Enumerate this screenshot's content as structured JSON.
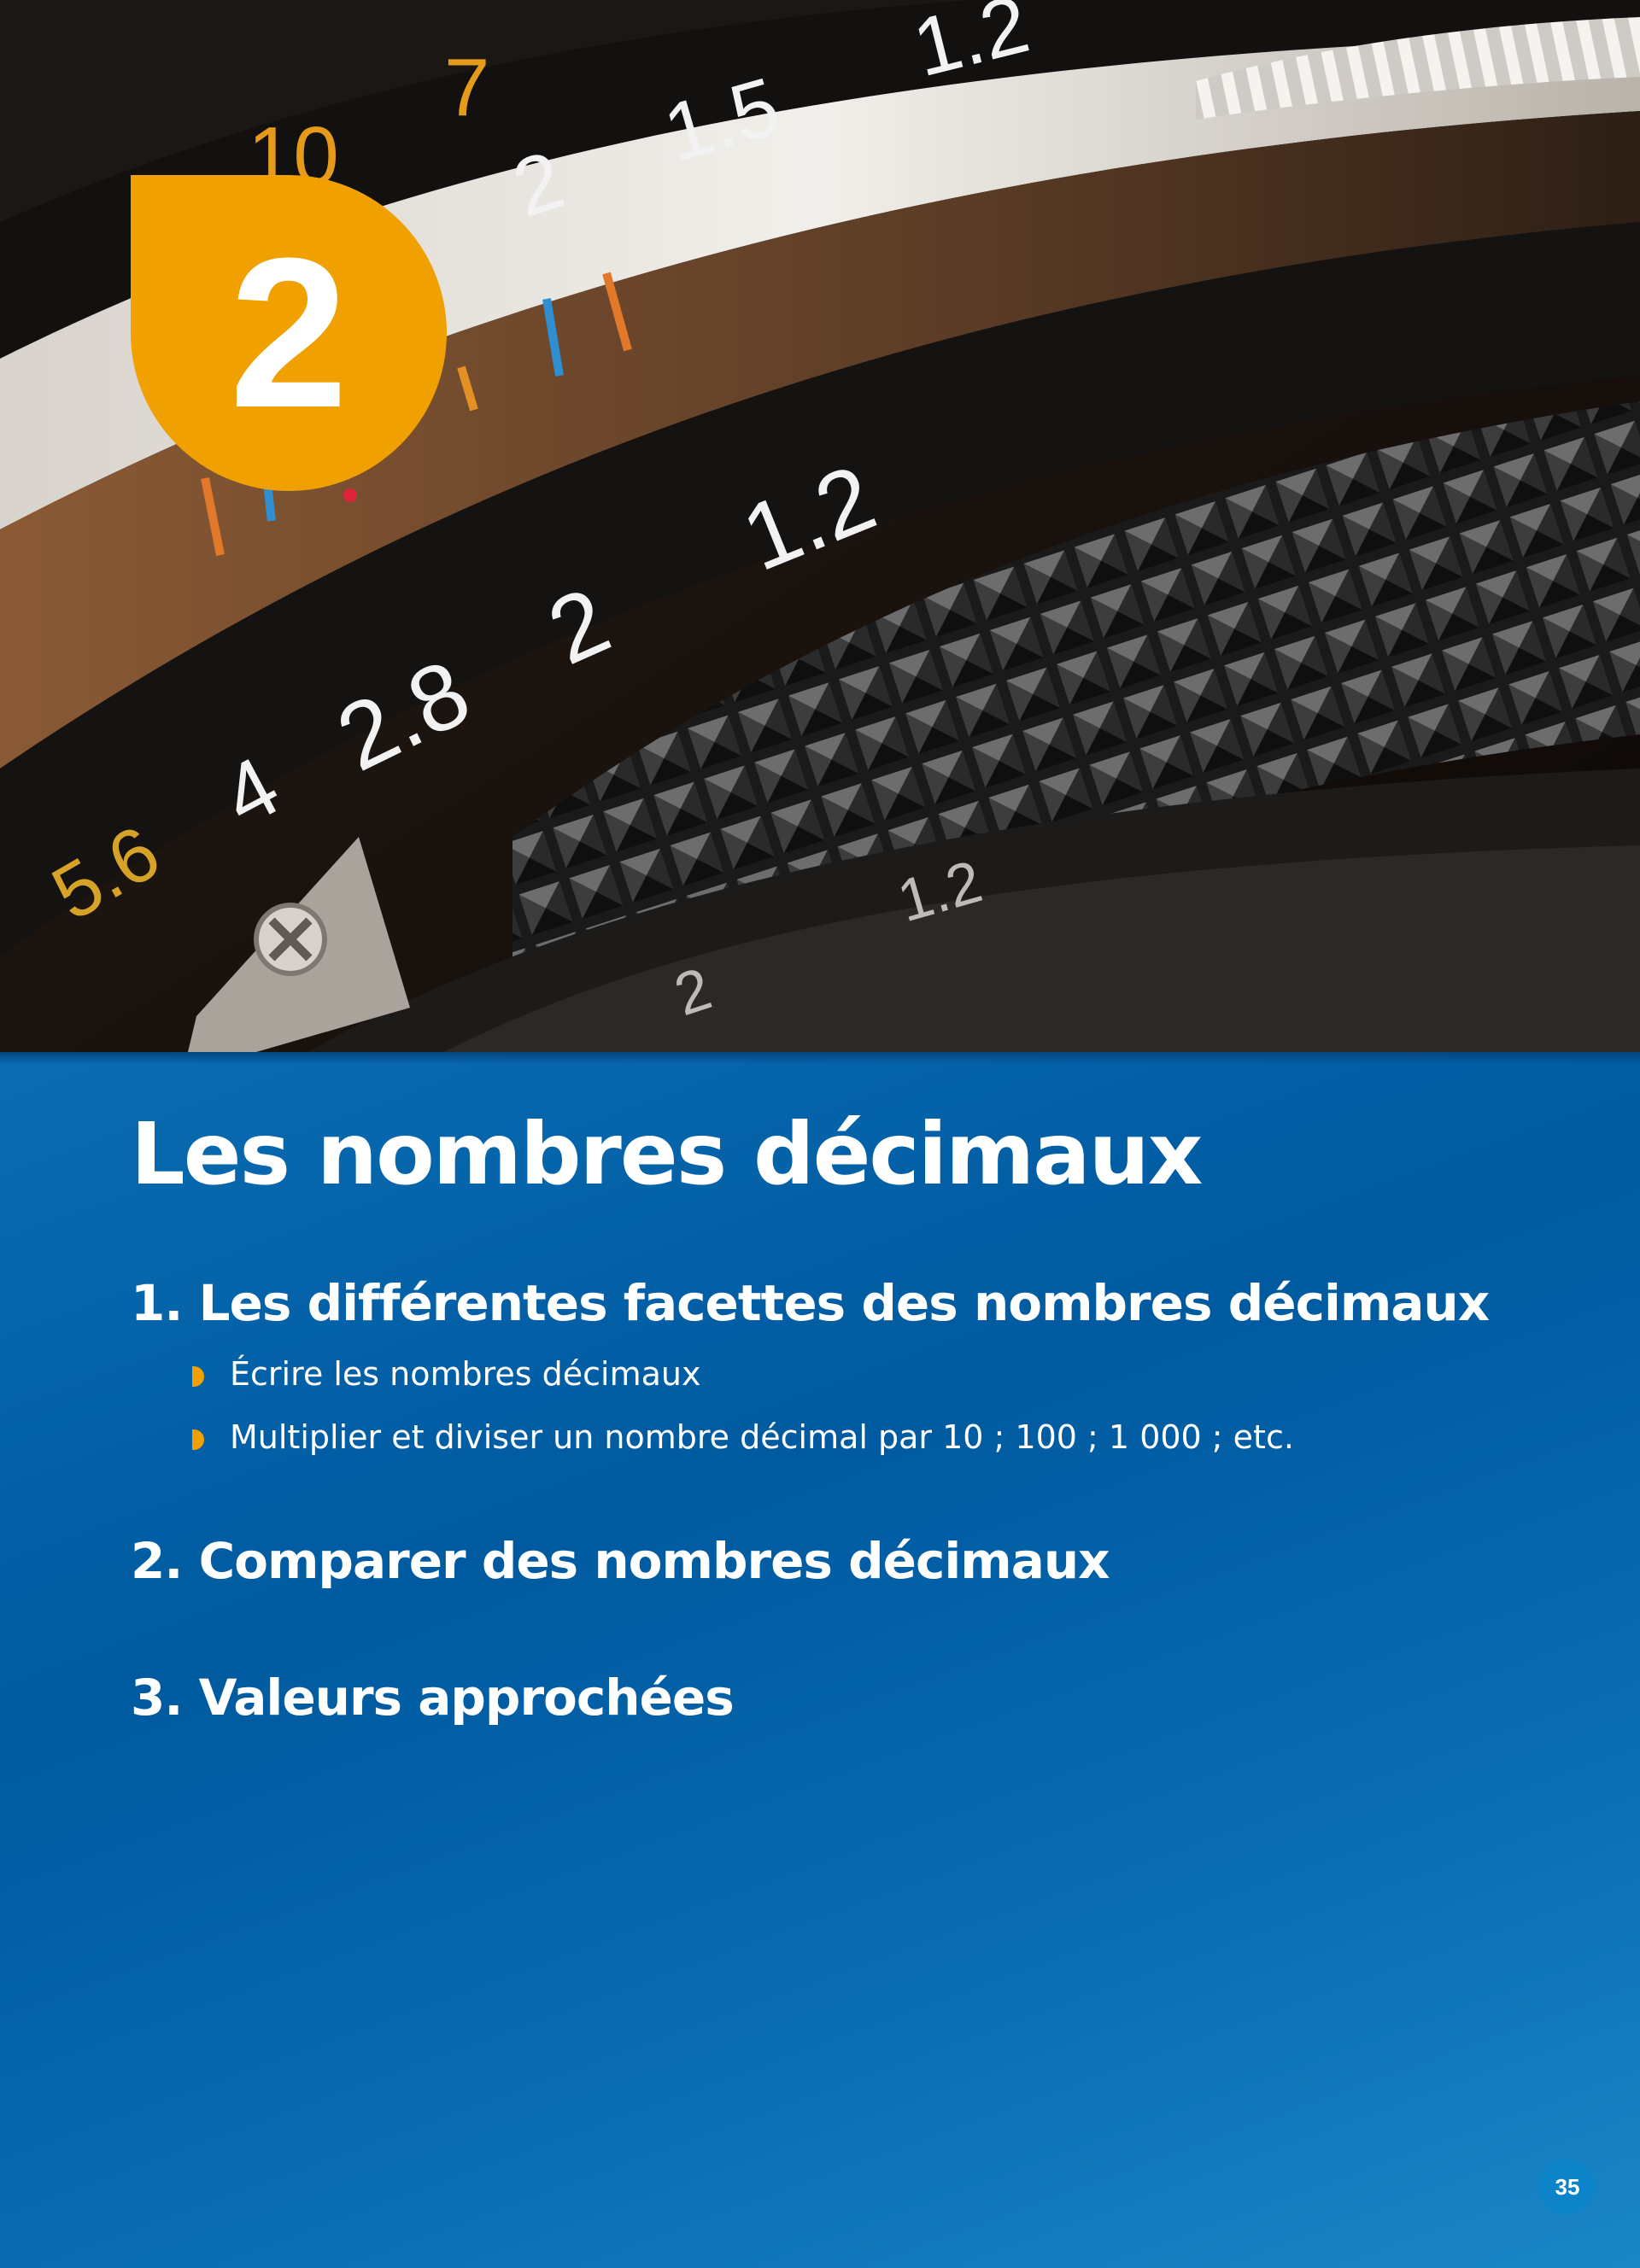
{
  "photo": {
    "description_icon": "camera-lens-icon",
    "focus_scale_top": [
      "7",
      "10",
      "2",
      "1.5",
      "1.2"
    ],
    "aperture_scale": [
      "5.6",
      "4",
      "2.8",
      "2",
      "1.2"
    ],
    "depth_scale": [
      "2",
      "1.2"
    ]
  },
  "chapter": {
    "number": "2",
    "title": "Les nombres décimaux",
    "accent_color": "#f0a000",
    "background_color": "#0a6db1"
  },
  "sections": [
    {
      "label": "1. Les différentes facettes des nombres décimaux",
      "items": [
        "Écrire les nombres décimaux",
        "Multiplier et diviser un nombre décimal par 10 ; 100 ; 1 000 ; etc."
      ]
    },
    {
      "label": "2. Comparer des nombres décimaux"
    },
    {
      "label": "3. Valeurs approchées"
    }
  ],
  "page_number": "35"
}
